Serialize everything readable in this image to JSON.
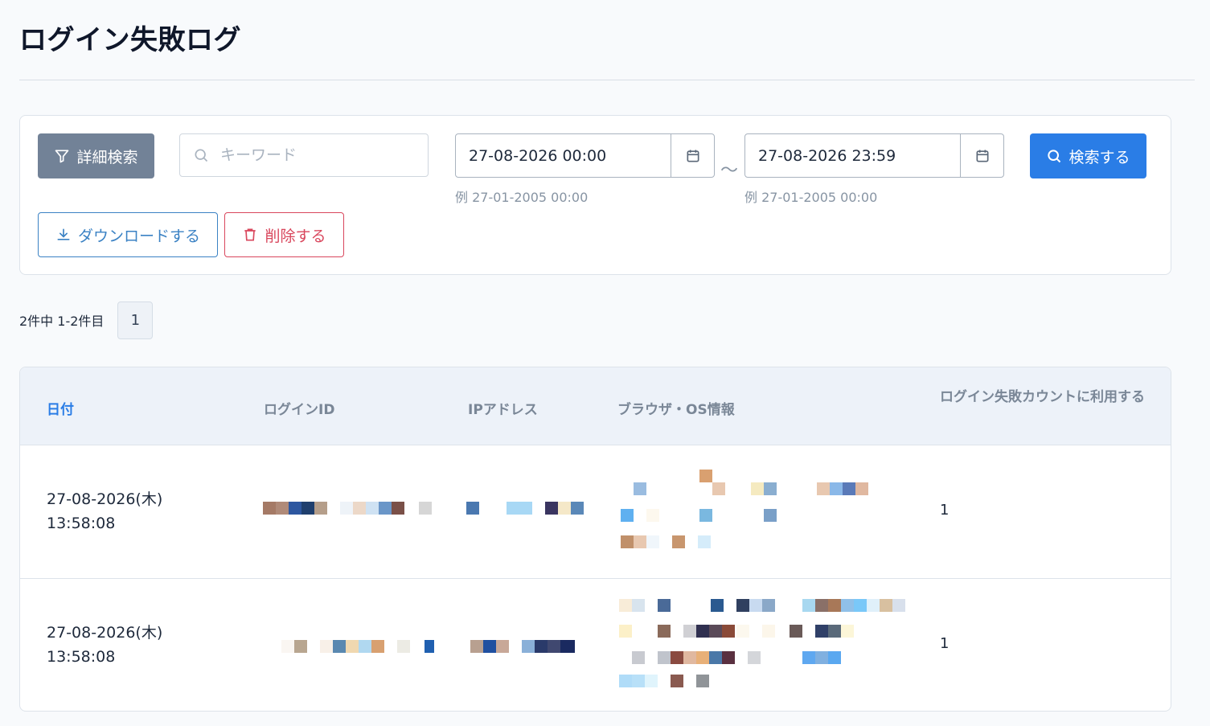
{
  "page": {
    "title": "ログイン失敗ログ"
  },
  "search": {
    "filter_label": "詳細検索",
    "keyword_placeholder": "キーワード",
    "keyword_value": "",
    "date_from_value": "27-08-2026 00:00",
    "date_to_value": "27-08-2026 23:59",
    "date_from_hint": "例 27-01-2005 00:00",
    "date_to_hint": "例 27-01-2005 00:00",
    "range_separator": "～",
    "search_label": "検索する",
    "download_label": "ダウンロードする",
    "delete_label": "削除する"
  },
  "colors": {
    "primary": "#2a7de6",
    "filter_bg": "#728297",
    "danger": "#d9475d",
    "download": "#3b82c4",
    "header_bg": "#edf2f9"
  },
  "icons": {
    "filter": "filter-icon",
    "search": "search-icon",
    "calendar": "calendar-icon",
    "download": "download-icon",
    "delete": "trash-icon"
  },
  "pagination": {
    "summary": "2件中 1-2件目",
    "current_page": "1"
  },
  "table": {
    "columns": [
      "日付",
      "ログインID",
      "IPアドレス",
      "ブラウザ・OS情報",
      "ログイン失敗カウントに利用する"
    ],
    "rows": [
      {
        "date": "27-08-2026(木)",
        "time": "13:58:08",
        "count": "1"
      },
      {
        "date": "27-08-2026(木)",
        "time": "13:58:08",
        "count": "1"
      }
    ]
  }
}
